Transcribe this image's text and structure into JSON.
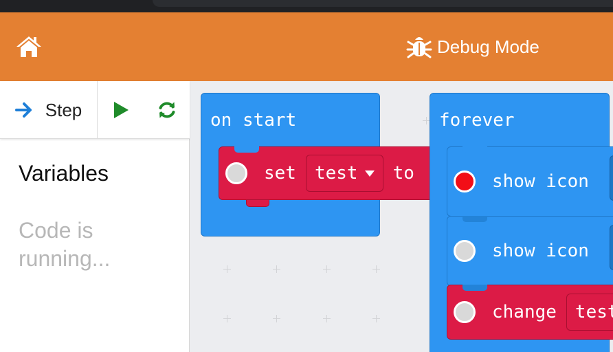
{
  "header": {
    "home_icon": "home-icon",
    "debug_icon": "bug-icon",
    "debug_label": "Debug Mode",
    "colors": {
      "header_bg": "#e48032",
      "header_text": "#ffffff"
    }
  },
  "debugger": {
    "step_label": "Step",
    "step_icon": "arrow-right-icon",
    "play_icon": "play-icon",
    "restart_icon": "refresh-icon",
    "variables_title": "Variables",
    "status_text": "Code is running..."
  },
  "workspace": {
    "on_start": {
      "label": "on start",
      "set_block": {
        "keyword": "set",
        "variable": "test",
        "to": "to"
      }
    },
    "forever": {
      "label": "forever",
      "blocks": [
        {
          "text": "show icon",
          "breakpoint_active": true
        },
        {
          "text": "show icon",
          "breakpoint_active": false
        },
        {
          "text": "change",
          "variable": "test"
        }
      ]
    },
    "colors": {
      "event_blue": "#2e95f2",
      "variable_red": "#dc1b46",
      "breakpoint_active": "#f20e17",
      "breakpoint_inactive": "#d9d9d9"
    }
  }
}
